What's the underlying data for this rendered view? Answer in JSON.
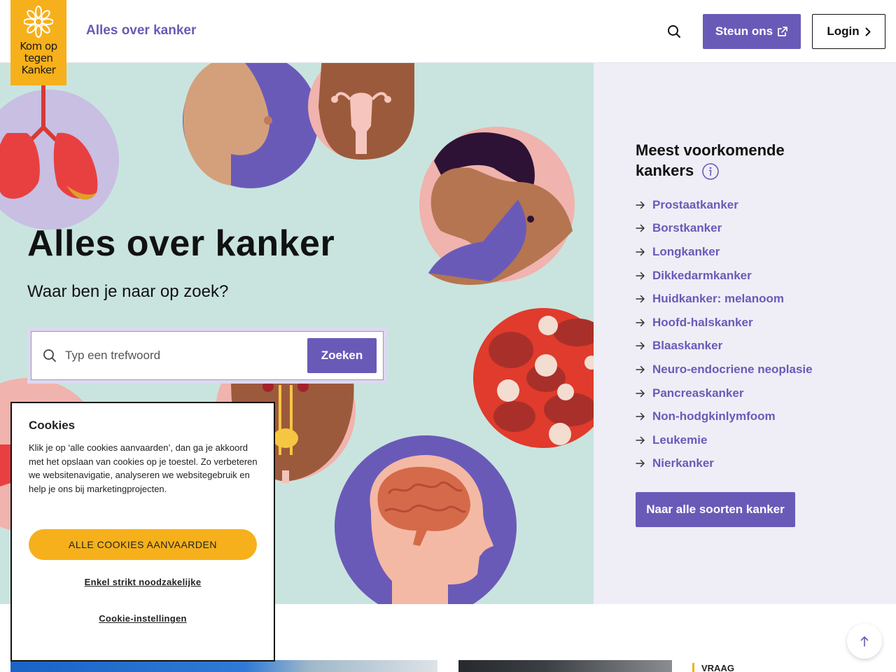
{
  "header": {
    "logo_lines": [
      "Kom op",
      "tegen",
      "Kanker"
    ],
    "site_title": "Alles over kanker",
    "support_label": "Steun ons",
    "login_label": "Login"
  },
  "hero": {
    "title": "Alles over kanker",
    "subtitle": "Waar ben je naar op zoek?",
    "search_placeholder": "Typ een trefwoord",
    "search_button": "Zoeken"
  },
  "sidebar": {
    "title": "Meest voorkomende kankers",
    "items": [
      {
        "label": "Prostaatkanker"
      },
      {
        "label": "Borstkanker"
      },
      {
        "label": "Longkanker"
      },
      {
        "label": "Dikkedarmkanker"
      },
      {
        "label": "Huidkanker: melanoom"
      },
      {
        "label": "Hoofd-halskanker"
      },
      {
        "label": "Blaaskanker"
      },
      {
        "label": "Neuro-endocriene neoplasie"
      },
      {
        "label": "Pancreaskanker"
      },
      {
        "label": "Non-hodgkinlymfoom"
      },
      {
        "label": "Leukemie"
      },
      {
        "label": "Nierkanker"
      }
    ],
    "all_types_label": "Naar alle soorten kanker"
  },
  "cookie": {
    "title": "Cookies",
    "text": "Klik je op ‘alle cookies aanvaarden’, dan ga je akkoord met het opslaan van cookies op je toestel. Zo verbeteren we websitenavigatie, analyseren we websitegebruik en help je ons bij marketingprojecten.",
    "accept_all": "ALLE COOKIES AANVAARDEN",
    "strict_only": "Enkel strikt noodzakelijke",
    "settings": "Cookie-instellingen"
  },
  "bottom": {
    "tag": "VRAAG"
  },
  "colors": {
    "brand_purple": "#6a5ab8",
    "brand_yellow": "#f6b01b",
    "hero_bg": "#c9e4df",
    "sidebar_bg": "#efedf6"
  },
  "icons": {
    "search": "search-icon",
    "external": "external-link-icon",
    "chevron": "chevron-right-icon",
    "arrow": "arrow-right-icon",
    "info": "info-icon",
    "back_to_top": "arrow-up-icon"
  }
}
